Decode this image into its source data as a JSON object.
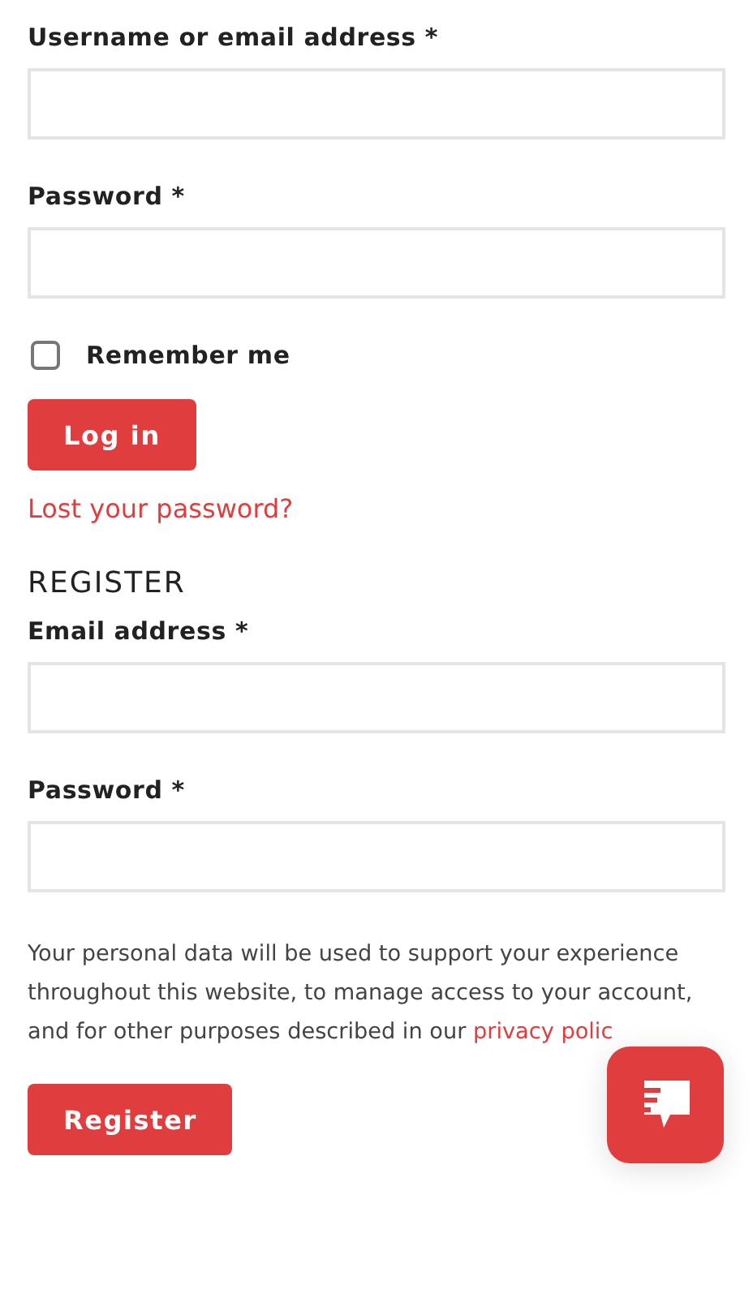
{
  "login": {
    "fields": [
      {
        "label": "Username or email address *"
      },
      {
        "label": "Password *"
      }
    ],
    "remember": {
      "label": "Remember me",
      "checked": false
    },
    "button": "Log in",
    "lost_password": "Lost your password?"
  },
  "register": {
    "heading": "REGISTER",
    "fields": [
      {
        "label": "Email address *"
      },
      {
        "label": "Password *"
      }
    ],
    "privacy_text": "Your personal data will be used to support your experience throughout this website, to manage access to your account, and for other purposes described in our ",
    "privacy_link": "privacy polic",
    "button": "Register"
  }
}
